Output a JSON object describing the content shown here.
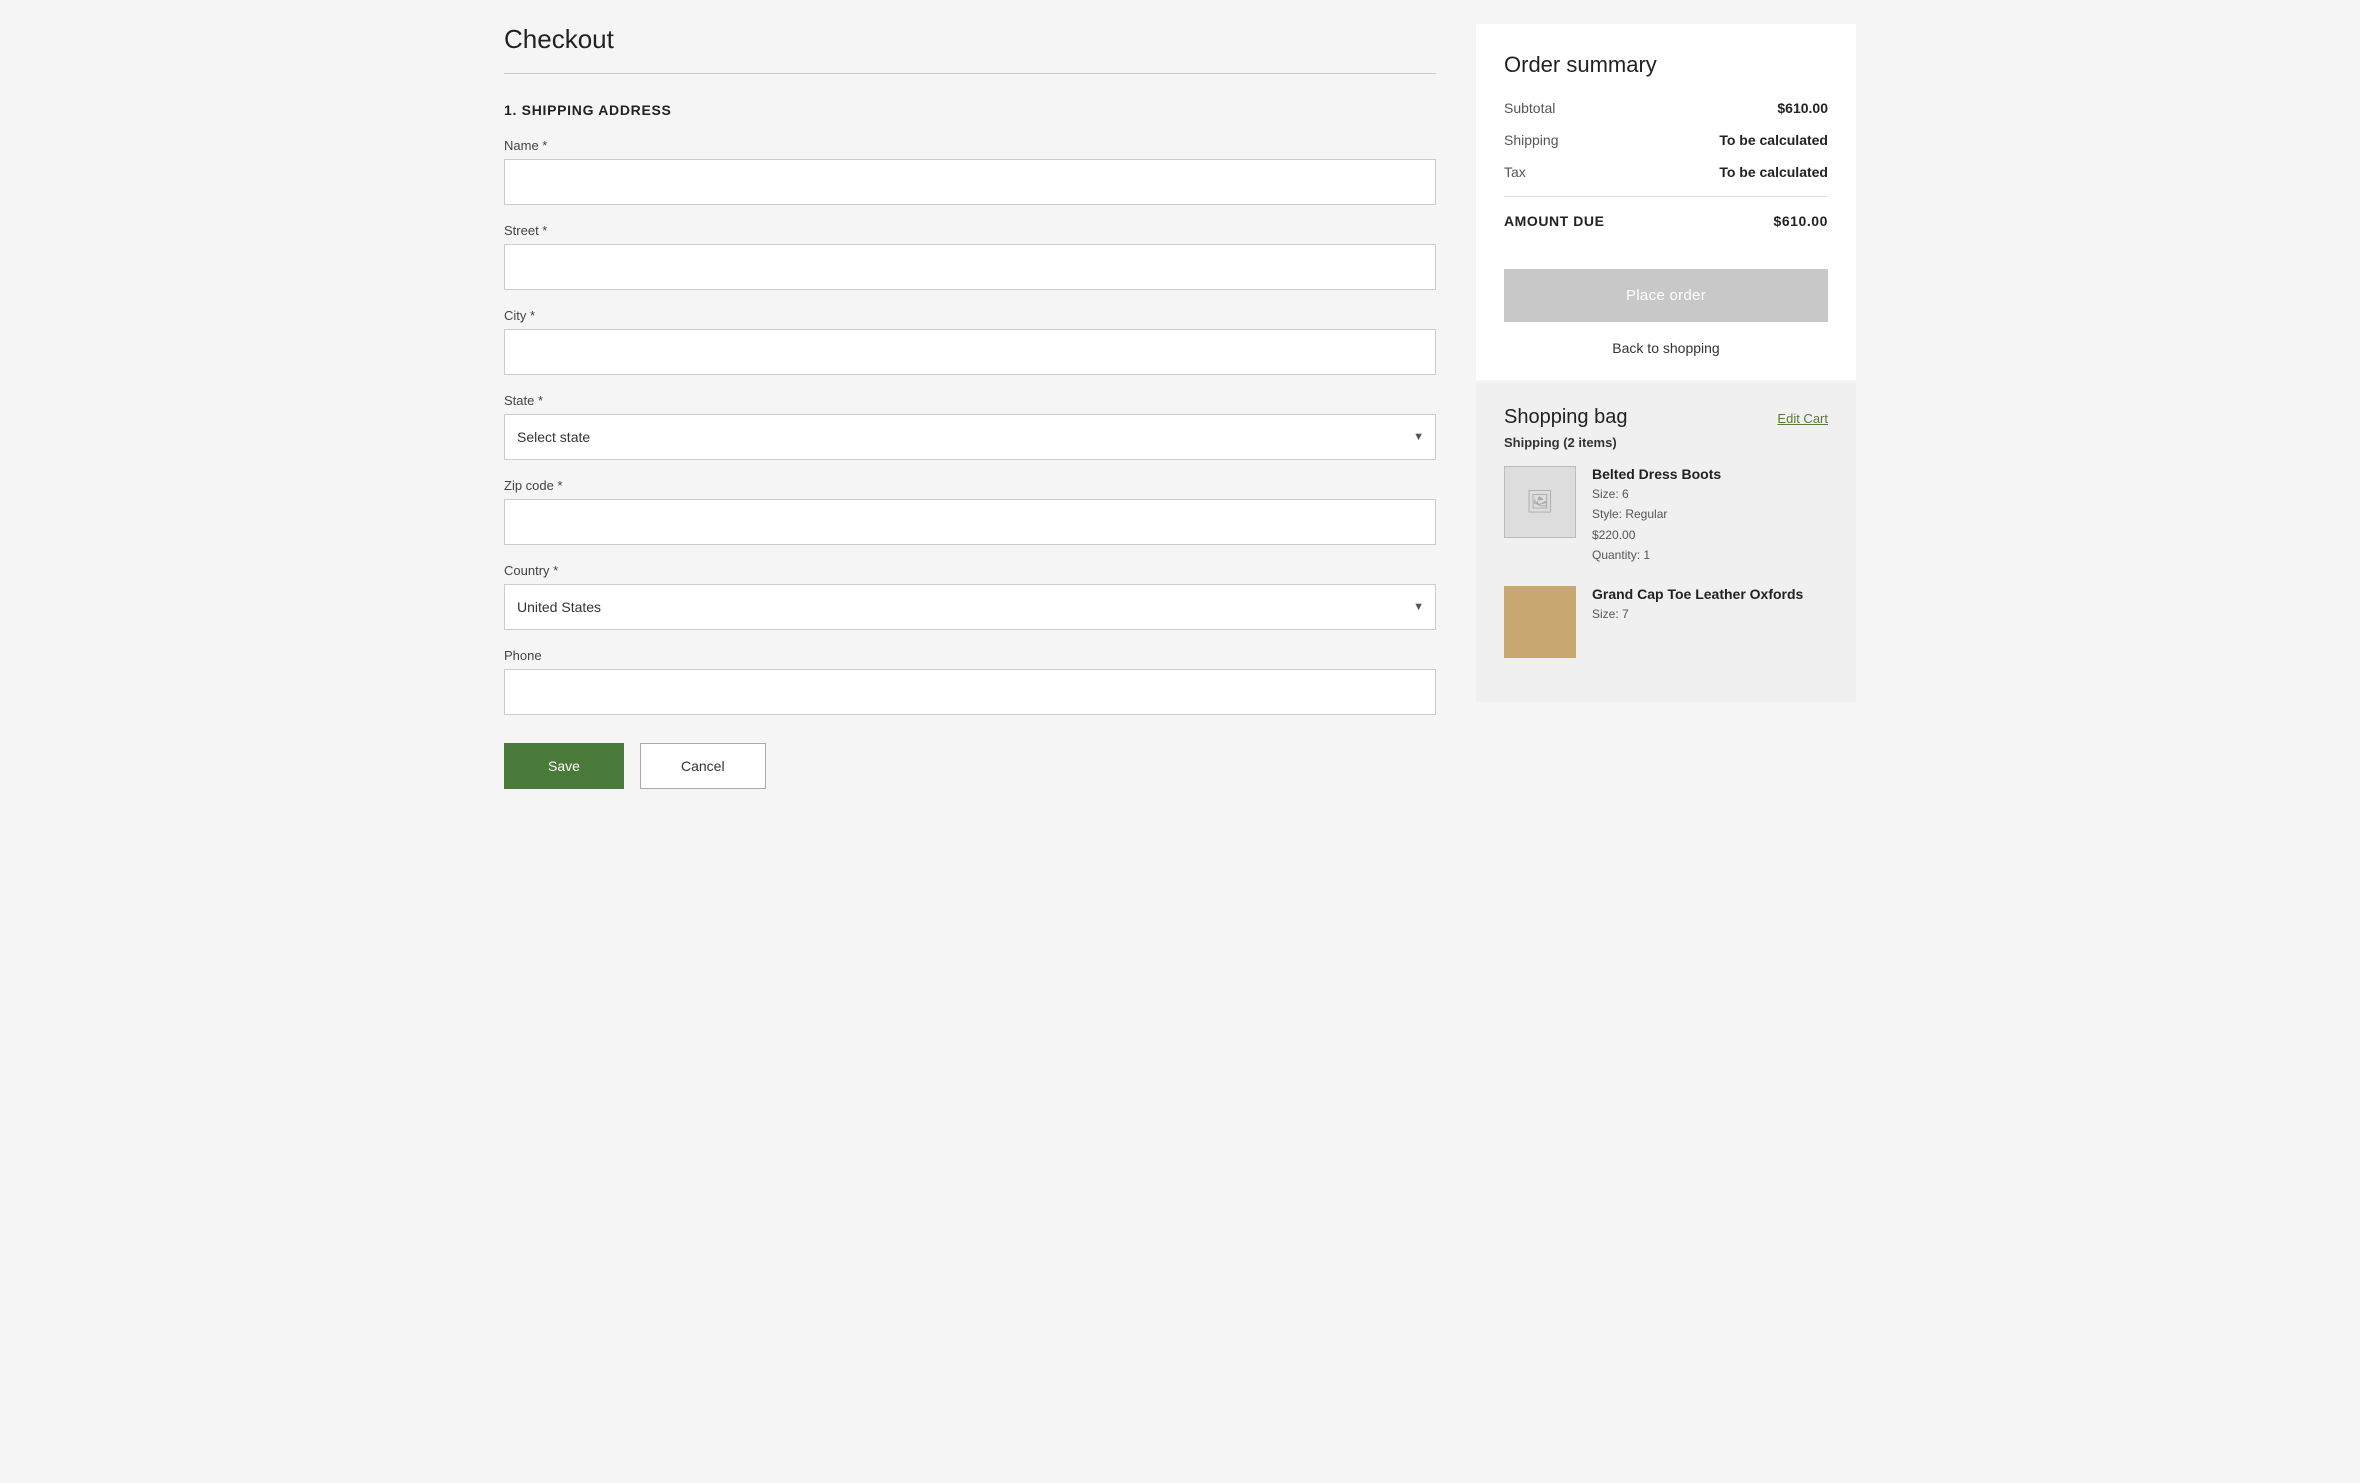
{
  "page": {
    "title": "Checkout"
  },
  "form": {
    "section_title": "1. SHIPPING ADDRESS",
    "fields": {
      "name_label": "Name *",
      "name_placeholder": "",
      "street_label": "Street *",
      "street_placeholder": "",
      "city_label": "City *",
      "city_placeholder": "",
      "state_label": "State *",
      "state_placeholder": "Select state",
      "zip_label": "Zip code *",
      "zip_placeholder": "",
      "country_label": "Country *",
      "country_value": "United States",
      "phone_label": "Phone",
      "phone_placeholder": ""
    },
    "buttons": {
      "save": "Save",
      "cancel": "Cancel"
    }
  },
  "order_summary": {
    "title": "Order summary",
    "subtotal_label": "Subtotal",
    "subtotal_value": "$610.00",
    "shipping_label": "Shipping",
    "shipping_value": "To be calculated",
    "tax_label": "Tax",
    "tax_value": "To be calculated",
    "amount_due_label": "AMOUNT DUE",
    "amount_due_value": "$610.00",
    "place_order_label": "Place order",
    "back_to_shopping_label": "Back to shopping"
  },
  "shopping_bag": {
    "title": "Shopping bag",
    "edit_cart_label": "Edit Cart",
    "shipping_label": "Shipping (2 items)",
    "items": [
      {
        "name": "Belted Dress Boots",
        "size": "Size: 6",
        "style": "Style: Regular",
        "price": "$220.00",
        "quantity": "Quantity: 1",
        "has_image": false
      },
      {
        "name": "Grand Cap Toe Leather Oxfords",
        "size": "Size: 7",
        "style": "",
        "price": "",
        "quantity": "",
        "has_image": true
      }
    ]
  },
  "icons": {
    "dropdown_arrow": "▼",
    "image_placeholder": "🖼"
  }
}
